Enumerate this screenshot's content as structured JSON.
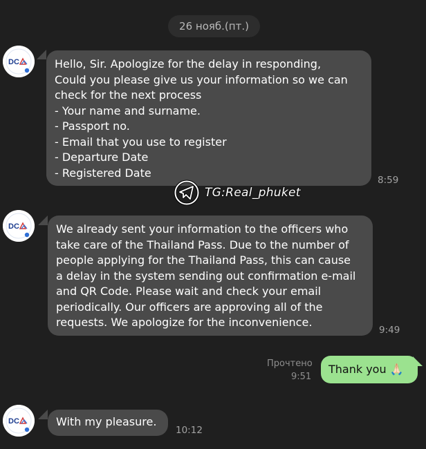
{
  "date_separator": "26 нояб.(пт.)",
  "messages": [
    {
      "lines": [
        "Hello, Sir. Apologize for the delay in responding,",
        "Could you please give us your information so we can",
        "check for the next process",
        "- Your name and surname.",
        "- Passport no.",
        "- Email that you use to register",
        "- Departure Date",
        "- Registered Date"
      ],
      "time": "8:59"
    },
    {
      "lines": [
        "We already sent your information to the officers who",
        "take care of the Thailand Pass. Due to the number of",
        "people applying for the Thailand Pass, this can cause",
        "a delay in the system sending out confirmation e-mail",
        "and QR Code. Please wait and check your email",
        "periodically. Our officers are approving all of the",
        "requests. We apologize for the inconvenience."
      ],
      "time": "9:49"
    },
    {
      "lines": [
        "With my pleasure."
      ],
      "time": "10:12"
    }
  ],
  "outgoing": {
    "text": "Thank you 🙏🏻",
    "status": "Прочтено",
    "time": "9:51"
  },
  "avatar": {
    "label": "DC"
  },
  "watermark": {
    "text": "TG:Real_phuket"
  },
  "colors": {
    "background": "#1f1f1f",
    "incoming_bubble": "#4a4a4a",
    "outgoing_bubble": "#9be28f",
    "timestamp": "#a3a3a3"
  }
}
